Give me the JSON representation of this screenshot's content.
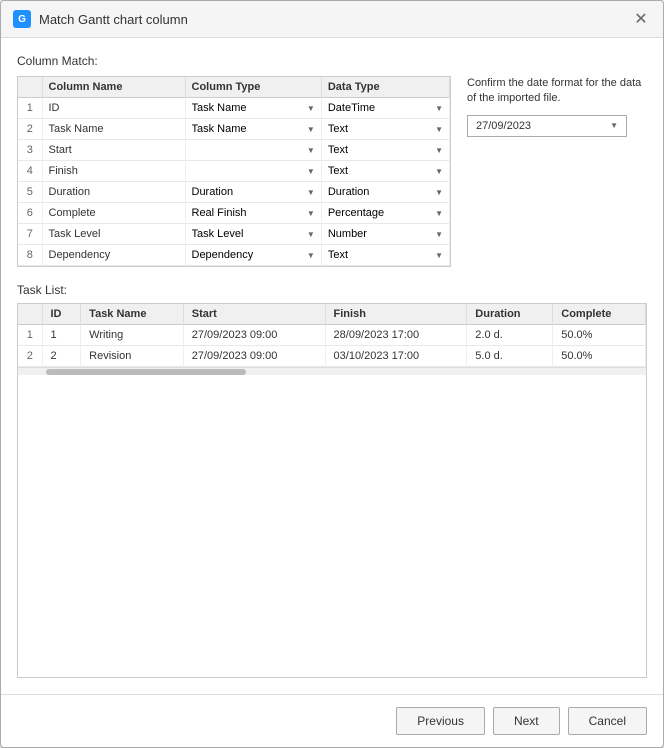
{
  "window": {
    "title": "Match Gantt chart column",
    "icon": "gantt-icon"
  },
  "column_match_label": "Column Match:",
  "table_headers": [
    "",
    "Column Name",
    "Column Type",
    "Data Type"
  ],
  "table_rows": [
    {
      "num": 1,
      "column_name": "ID",
      "column_type": "Task Name",
      "data_type": "DateTime"
    },
    {
      "num": 2,
      "column_name": "Task Name",
      "column_type": "Task Name",
      "data_type": "Text"
    },
    {
      "num": 3,
      "column_name": "Start",
      "column_type": "",
      "data_type": "Text"
    },
    {
      "num": 4,
      "column_name": "Finish",
      "column_type": "",
      "data_type": "Text"
    },
    {
      "num": 5,
      "column_name": "Duration",
      "column_type": "Duration",
      "data_type": "Duration"
    },
    {
      "num": 6,
      "column_name": "Complete",
      "column_type": "Real Finish",
      "data_type": "Percentage"
    },
    {
      "num": 7,
      "column_name": "Task Level",
      "column_type": "Task Level",
      "data_type": "Number"
    },
    {
      "num": 8,
      "column_name": "Dependency",
      "column_type": "Dependency",
      "data_type": "Text"
    }
  ],
  "right_panel": {
    "confirm_text": "Confirm the date format for the data of the imported file.",
    "date_value": "27/09/2023"
  },
  "task_list_label": "Task List:",
  "task_headers": [
    "ID",
    "Task Name",
    "Start",
    "Finish",
    "Duration",
    "Complete"
  ],
  "task_rows": [
    {
      "row_num": 1,
      "id": "1",
      "task_name": "Writing",
      "start": "27/09/2023 09:00",
      "finish": "28/09/2023 17:00",
      "duration": "2.0 d.",
      "complete": "50.0%"
    },
    {
      "row_num": 2,
      "id": "2",
      "task_name": "Revision",
      "start": "27/09/2023 09:00",
      "finish": "03/10/2023 17:00",
      "duration": "5.0 d.",
      "complete": "50.0%"
    }
  ],
  "buttons": {
    "previous": "Previous",
    "next": "Next",
    "cancel": "Cancel"
  }
}
